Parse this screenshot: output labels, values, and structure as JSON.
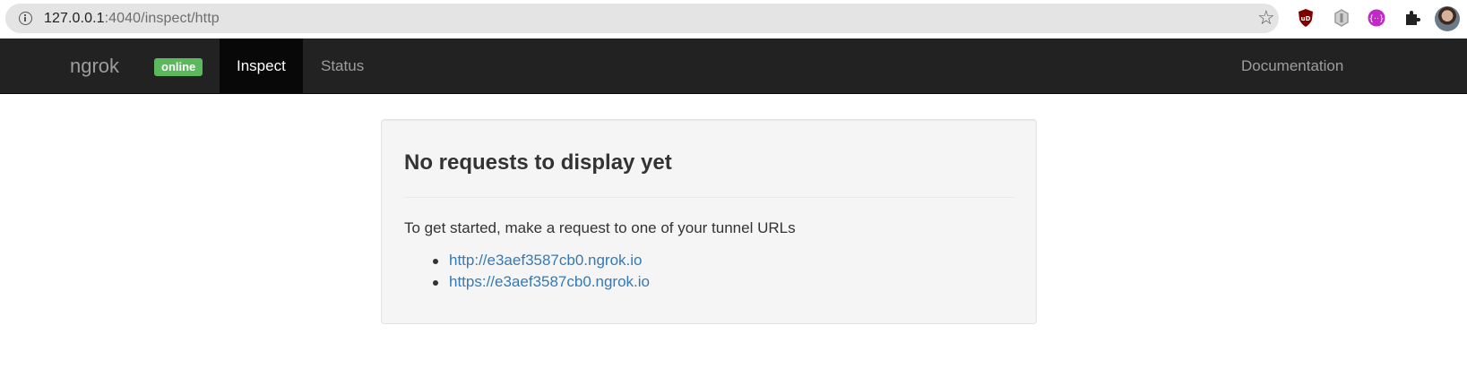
{
  "browser": {
    "url_host": "127.0.0.1",
    "url_path": ":4040/inspect/http",
    "icons": [
      "info-icon",
      "star-icon",
      "ublock-icon",
      "shield-extension-icon",
      "purple-extension-icon",
      "puzzle-extensions-icon",
      "profile-avatar"
    ]
  },
  "navbar": {
    "brand": "ngrok",
    "status_badge": "online",
    "items": [
      {
        "label": "Inspect",
        "active": true
      },
      {
        "label": "Status",
        "active": false
      }
    ],
    "right_link": "Documentation"
  },
  "main": {
    "title": "No requests to display yet",
    "intro": "To get started, make a request to one of your tunnel URLs",
    "tunnels": [
      "http://e3aef3587cb0.ngrok.io",
      "https://e3aef3587cb0.ngrok.io"
    ]
  },
  "colors": {
    "navbar_bg": "#222222",
    "active_nav_bg": "#080808",
    "badge": "#5cb85c",
    "link": "#337ab7"
  }
}
